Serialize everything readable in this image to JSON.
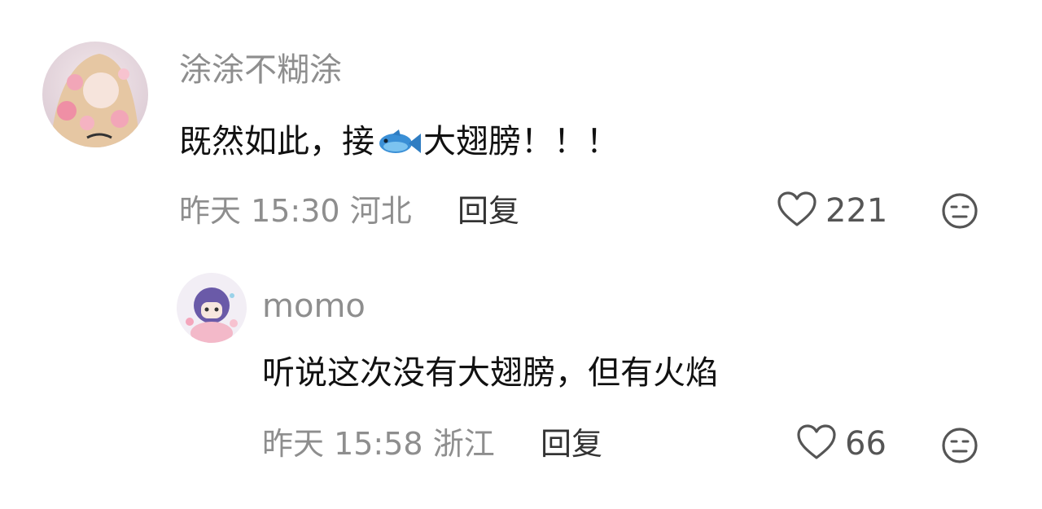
{
  "comments": [
    {
      "username": "涂涂不糊涂",
      "content_before": "既然如此，接",
      "content_after": "大翅膀！！！",
      "content_emoji": "fish-icon",
      "time": "昨天 15:30",
      "location": "河北",
      "reply_label": "回复",
      "likes": "221"
    },
    {
      "username": "momo",
      "content": "听说这次没有大翅膀，但有火焰",
      "time": "昨天 15:58",
      "location": "浙江",
      "reply_label": "回复",
      "likes": "66"
    }
  ],
  "colors": {
    "meta": "#8e8e8e",
    "text": "#111111",
    "reply": "#333333"
  }
}
